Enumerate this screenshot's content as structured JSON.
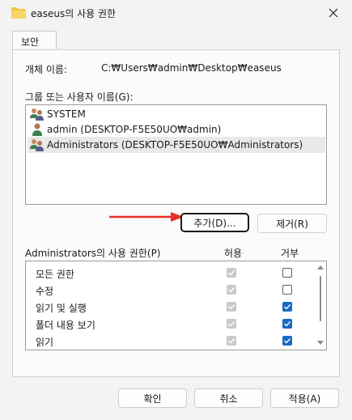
{
  "window": {
    "title": "easeus의 사용 권한"
  },
  "tabs": [
    {
      "label": "보안"
    }
  ],
  "object": {
    "label": "개체 이름:",
    "value": "C:₩Users₩admin₩Desktop₩easeus"
  },
  "groups": {
    "label": "그룹 또는 사용자 이름(G):",
    "items": [
      {
        "name": "SYSTEM",
        "icon": "users-icon"
      },
      {
        "name": "admin (DESKTOP-F5E50UO₩admin)",
        "icon": "user-icon"
      },
      {
        "name": "Administrators (DESKTOP-F5E50UO₩Administrators)",
        "icon": "users-icon"
      }
    ],
    "selected_index": 2
  },
  "buttons": {
    "add": "추가(D)...",
    "remove": "제거(R)",
    "ok": "확인",
    "cancel": "취소",
    "apply": "적용(A)"
  },
  "permissions": {
    "label": "Administrators의 사용 권한(P)",
    "allow_header": "허용",
    "deny_header": "거부",
    "rows": [
      {
        "name": "모든 권한",
        "allow": true,
        "deny": false
      },
      {
        "name": "수정",
        "allow": true,
        "deny": false
      },
      {
        "name": "읽기 및 실행",
        "allow": true,
        "deny": true
      },
      {
        "name": "폴더 내용 보기",
        "allow": true,
        "deny": true
      },
      {
        "name": "읽기",
        "allow": true,
        "deny": true
      }
    ]
  },
  "colors": {
    "accent": "#1769c4",
    "annotation_arrow": "#e8312a"
  }
}
